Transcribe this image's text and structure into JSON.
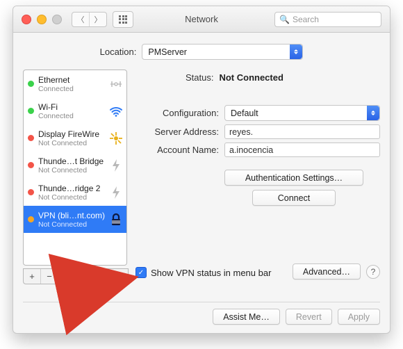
{
  "window": {
    "title": "Network"
  },
  "search": {
    "placeholder": "Search"
  },
  "location": {
    "label": "Location:",
    "value": "PMServer"
  },
  "sidebar": {
    "items": [
      {
        "name": "Ethernet",
        "status": "Connected",
        "dot": "green",
        "icon": "ethernet"
      },
      {
        "name": "Wi-Fi",
        "status": "Connected",
        "dot": "green",
        "icon": "wifi"
      },
      {
        "name": "Display FireWire",
        "status": "Not Connected",
        "dot": "red",
        "icon": "firewire"
      },
      {
        "name": "Thunde…t Bridge",
        "status": "Not Connected",
        "dot": "red",
        "icon": "thunderbolt"
      },
      {
        "name": "Thunde…ridge 2",
        "status": "Not Connected",
        "dot": "red",
        "icon": "thunderbolt"
      },
      {
        "name": "VPN (bli…nt.com)",
        "status": "Not Connected",
        "dot": "orange",
        "icon": "vpn"
      }
    ],
    "footer": {
      "add": "+",
      "remove": "−",
      "gear": "⚙︎▾"
    }
  },
  "detail": {
    "status_label": "Status:",
    "status_value": "Not Connected",
    "config_label": "Configuration:",
    "config_value": "Default",
    "server_label": "Server Address:",
    "server_value": "reyes.",
    "account_label": "Account Name:",
    "account_value": "a.inocencia",
    "auth_button": "Authentication Settings…",
    "connect_button": "Connect",
    "show_status_label": "Show VPN status in menu bar",
    "show_status_checked": true,
    "advanced_button": "Advanced…"
  },
  "buttons": {
    "assist": "Assist Me…",
    "revert": "Revert",
    "apply": "Apply"
  }
}
